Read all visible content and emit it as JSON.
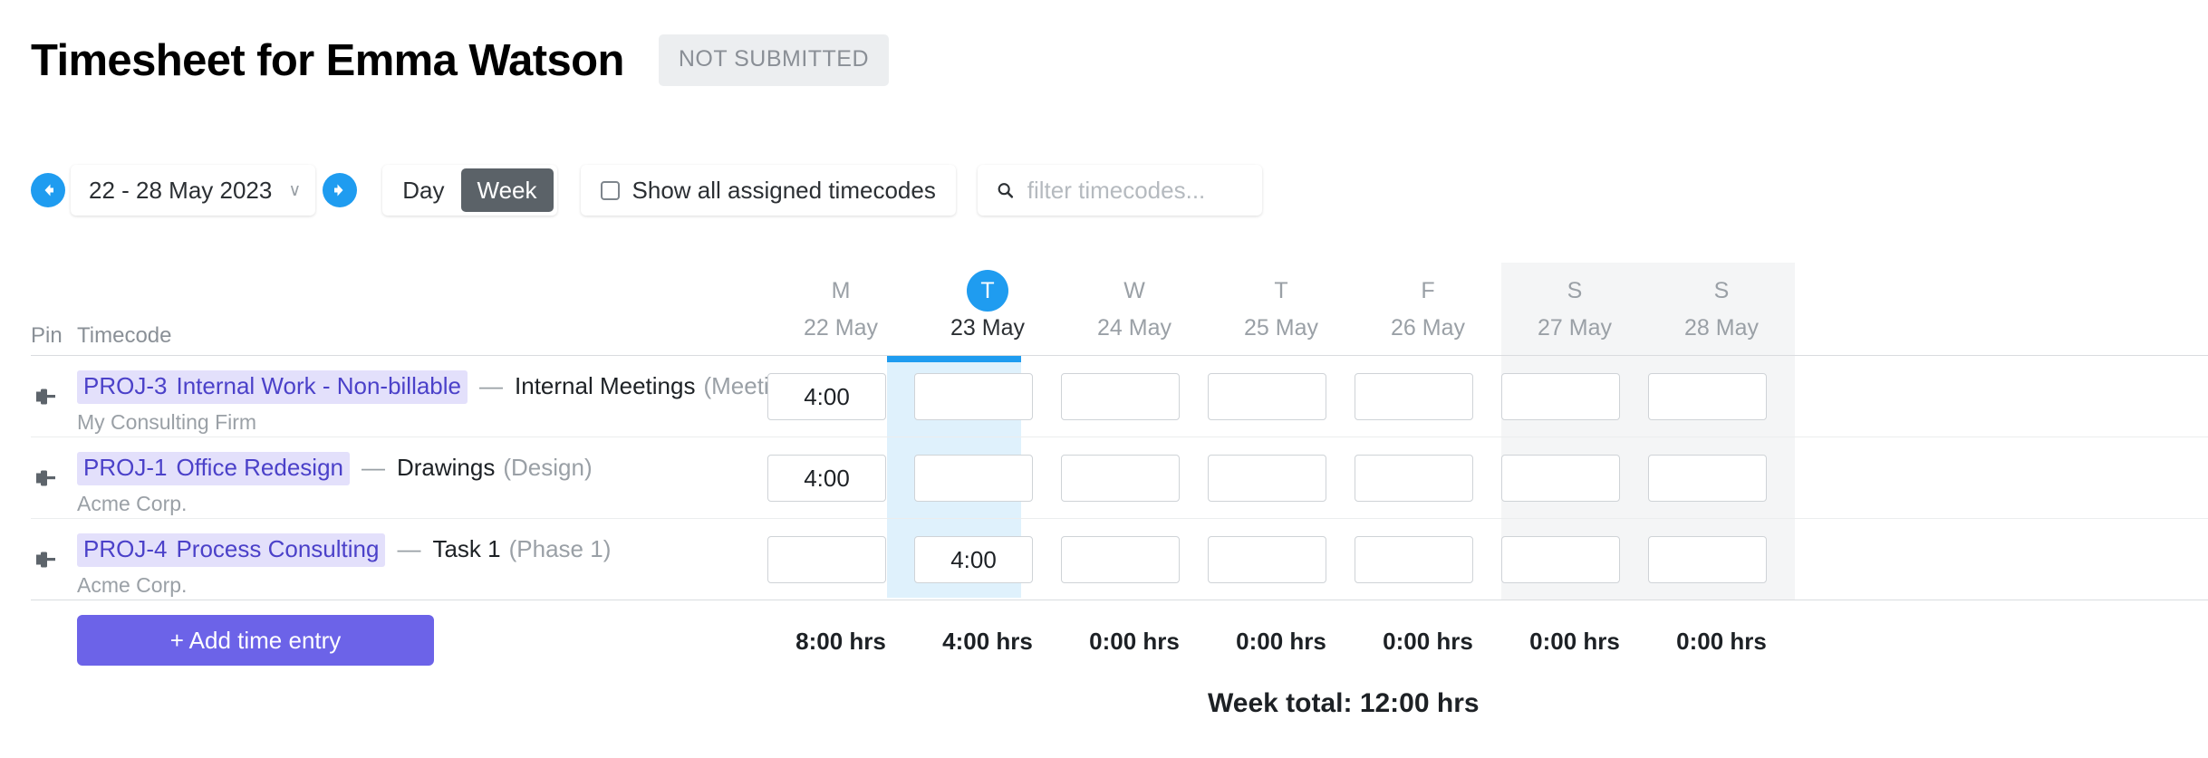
{
  "header": {
    "title": "Timesheet for Emma Watson",
    "status_badge": "NOT SUBMITTED"
  },
  "toolbar": {
    "prev_label": "previous week",
    "next_label": "next week",
    "date_range": "22 - 28 May 2023",
    "chevron": "∨",
    "day_label": "Day",
    "week_label": "Week",
    "active_view": "Week",
    "show_all_label": "Show all assigned timecodes",
    "show_all_checked": false,
    "filter_value": "",
    "filter_placeholder": "filter timecodes..."
  },
  "table": {
    "col_pin": "Pin",
    "col_timecode": "Timecode",
    "days": [
      {
        "letter": "M",
        "date": "22 May",
        "today": false,
        "weekend": false
      },
      {
        "letter": "T",
        "date": "23 May",
        "today": true,
        "weekend": false
      },
      {
        "letter": "W",
        "date": "24 May",
        "today": false,
        "weekend": false
      },
      {
        "letter": "T",
        "date": "25 May",
        "today": false,
        "weekend": false
      },
      {
        "letter": "F",
        "date": "26 May",
        "today": false,
        "weekend": false
      },
      {
        "letter": "S",
        "date": "27 May",
        "today": false,
        "weekend": true
      },
      {
        "letter": "S",
        "date": "28 May",
        "today": false,
        "weekend": true
      }
    ],
    "rows": [
      {
        "pin_icon": "pin-icon",
        "code": "PROJ-3",
        "project": "Internal Work - Non-billable",
        "dash": "—",
        "task": "Internal Meetings",
        "paren": "(Meeti...",
        "client": "My Consulting Firm",
        "entries": [
          "4:00",
          "",
          "",
          "",
          "",
          "",
          ""
        ]
      },
      {
        "pin_icon": "pin-icon",
        "code": "PROJ-1",
        "project": "Office Redesign",
        "dash": "—",
        "task": "Drawings",
        "paren": "(Design)",
        "client": "Acme Corp.",
        "entries": [
          "4:00",
          "",
          "",
          "",
          "",
          "",
          ""
        ]
      },
      {
        "pin_icon": "pin-icon",
        "code": "PROJ-4",
        "project": "Process Consulting",
        "dash": "—",
        "task": "Task 1",
        "paren": "(Phase 1)",
        "client": "Acme Corp.",
        "entries": [
          "",
          "4:00",
          "",
          "",
          "",
          "",
          ""
        ]
      }
    ],
    "add_entry_label": "+ Add time entry",
    "day_totals": [
      "8:00 hrs",
      "4:00 hrs",
      "0:00 hrs",
      "0:00 hrs",
      "0:00 hrs",
      "0:00 hrs",
      "0:00 hrs"
    ],
    "week_total": "Week total: 12:00 hrs"
  },
  "colors": {
    "accent_blue": "#1f9cf0",
    "today_band": "#d4ecfb",
    "chip_bg": "#e3e0fb",
    "chip_text": "#4b41c9",
    "add_button": "#6c63e8",
    "segment_active": "#5b6268",
    "badge_bg": "#eceef0",
    "weekend_band": "#f4f5f6"
  }
}
